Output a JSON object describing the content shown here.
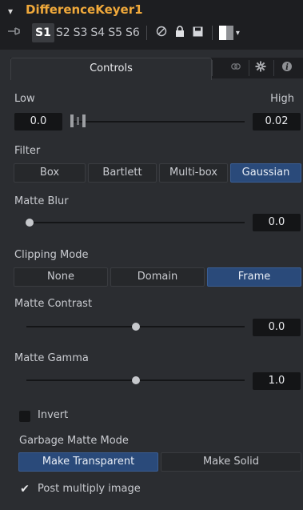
{
  "header": {
    "collapse_icon": "▾",
    "title": "DifferenceKeyer1",
    "slots": [
      "S1",
      "S2",
      "S3",
      "S4",
      "S5",
      "S6"
    ],
    "active_slot": "S1"
  },
  "tabs": {
    "controls_label": "Controls"
  },
  "low_high": {
    "low_label": "Low",
    "high_label": "High",
    "low_value": "0.0",
    "high_value": "0.02"
  },
  "filter": {
    "label": "Filter",
    "options": [
      "Box",
      "Bartlett",
      "Multi-box",
      "Gaussian"
    ],
    "selected": "Gaussian"
  },
  "matte_blur": {
    "label": "Matte Blur",
    "value": "0.0",
    "slider_fraction": 0.0
  },
  "clipping_mode": {
    "label": "Clipping Mode",
    "options": [
      "None",
      "Domain",
      "Frame"
    ],
    "selected": "Frame"
  },
  "matte_contrast": {
    "label": "Matte Contrast",
    "value": "0.0",
    "slider_fraction": 0.5
  },
  "matte_gamma": {
    "label": "Matte Gamma",
    "value": "1.0",
    "slider_fraction": 0.5
  },
  "invert": {
    "label": "Invert",
    "checked": false
  },
  "garbage_matte": {
    "label": "Garbage Matte Mode",
    "options": [
      "Make Transparent",
      "Make Solid"
    ],
    "selected": "Make Transparent"
  },
  "post_multiply": {
    "label": "Post multiply image",
    "checked": true
  },
  "colors": {
    "accent_title": "#f0a93b",
    "selected_button": "#2a4a7a",
    "panel_bg": "#2b2d31",
    "field_bg": "#141517"
  },
  "icons": [
    "collapse-icon",
    "pin-icon",
    "disable-icon",
    "lock-icon",
    "save-icon",
    "color-swatch-icon",
    "chain-icon",
    "gear-icon",
    "info-icon",
    "checkmark-icon"
  ]
}
